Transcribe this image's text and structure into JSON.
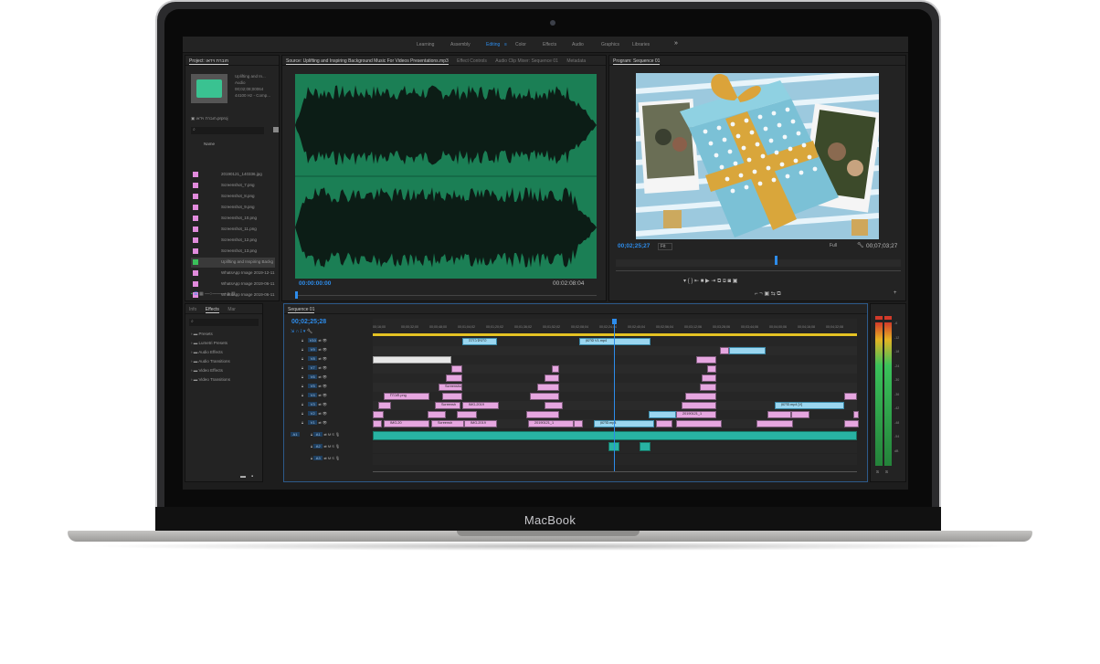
{
  "device": {
    "brand": "MacBook"
  },
  "workspace_tabs": [
    "Learning",
    "Assembly",
    "Editing",
    "Color",
    "Effects",
    "Audio",
    "Graphics",
    "Libraries"
  ],
  "active_workspace": "Editing",
  "project_panel": {
    "title": "Project: חוברת וידאו",
    "clip_name": "Uplifting and In...",
    "clip_type": "Audio",
    "clip_duration": "00;02;08;00064",
    "clip_rate": "44100 Hz - Comp...",
    "project_file": "חוברת וידאו.prproj",
    "column_name": "Name",
    "files": [
      "20190121_140336.jpg",
      "Screenshot_7.png",
      "Screenshot_8.png",
      "Screenshot_9.png",
      "Screenshot_10.png",
      "Screenshot_11.png",
      "Screenshot_12.png",
      "Screenshot_13.png",
      "Uplifting and Inspiring Backg",
      "WhatsApp Image 2019-12-11",
      "WhatsApp Image 2019-06-11",
      "WhatsApp Image 2019-06-11"
    ],
    "selected_index": 8
  },
  "source_panel": {
    "tabs": [
      "Source: Uplifting and Inspiring Background Music For Videos Presentations.mp3",
      "Effect Controls",
      "Audio Clip Mixer: Sequence 01",
      "Metadata"
    ],
    "timecode_in": "00:00:00:00",
    "timecode_out": "00:02:08:04"
  },
  "program_panel": {
    "title": "Program: Sequence 01",
    "timecode": "00;02;25;27",
    "fit": "Fit",
    "quality": "Full",
    "duration": "00;07;03;27"
  },
  "effects_panel": {
    "tabs": [
      "Info",
      "Effects",
      "Mar"
    ],
    "items": [
      "Presets",
      "Lumetri Presets",
      "Audio Effects",
      "Audio Transitions",
      "Video Effects",
      "Video Transitions"
    ]
  },
  "timeline": {
    "sequence_name": "Sequence 01",
    "timecode": "00;02;25;28",
    "ruler": [
      "00;16;00",
      "00;00;32;00",
      "00;00;48;00",
      "00;01;04;02",
      "00;01;20;02",
      "00;01;36;02",
      "00;01;52;02",
      "00;02;08;04",
      "00;02;24;04",
      "00;02;40;04",
      "00;02;56;04",
      "00;03;12;06",
      "00;03;28;06",
      "00;03;44;06",
      "00;04;00;06",
      "00;04;16;08",
      "00;04;32;08"
    ],
    "video_tracks": [
      "V10",
      "V9",
      "V8",
      "V7",
      "V6",
      "V5",
      "V4",
      "V3",
      "V2",
      "V1"
    ],
    "audio_tracks": [
      "A1",
      "A2",
      "A3"
    ],
    "clip_labels": {
      "c1": "IMG-2019",
      "c2": "Screenshot_1",
      "c3": "Screensh",
      "c4": "IMG-2019",
      "c5": "20190121_1",
      "c6": "כרטיס ברכה",
      "c7": "סרטון V1.mp4",
      "c8": "סרטון.mp4",
      "c9": "חוברת.png",
      "c10": "סרטון.mp4 [V]",
      "c11": "20190121_1",
      "c12": "IMG-20",
      "c13": "Screensh"
    }
  },
  "meter_scale": [
    "-6",
    "-12",
    "-18",
    "-24",
    "-30",
    "-36",
    "-42",
    "-48",
    "-54",
    "dB"
  ],
  "colors": {
    "accent": "#2d8ceb",
    "waveform": "#1b7f55",
    "clip_pink": "#e6a6e0",
    "clip_blue": "#9ad6f0",
    "clip_audio": "#28b3a3"
  }
}
